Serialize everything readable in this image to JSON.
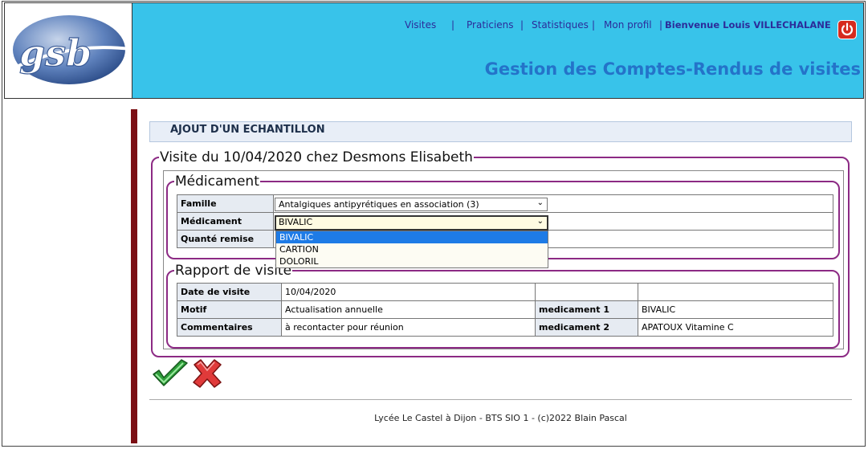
{
  "header": {
    "logo_text": "gsb",
    "nav": {
      "visites": "Visites",
      "praticiens": "Praticiens",
      "statistiques": "Statistiques",
      "profil": "Mon profil",
      "welcome": "Bienvenue Louis VILLECHALANE",
      "sep": "|"
    },
    "title": "Gestion des Comptes-Rendus de visites"
  },
  "section_title": "AJOUT D'UN ECHANTILLON",
  "visit_legend": "Visite du 10/04/2020 chez Desmons Elisabeth",
  "medicament": {
    "legend": "Médicament",
    "famille_label": "Famille",
    "famille_value": "Antalgiques antipyrétiques en association (3)",
    "medicament_label": "Médicament",
    "medicament_value": "BIVALIC",
    "quantite_label": "Quanté remise",
    "options": [
      "BIVALIC",
      "CARTION",
      "DOLORIL"
    ]
  },
  "rapport": {
    "legend": "Rapport de visite",
    "date_label": "Date de visite",
    "date_value": "10/04/2020",
    "motif_label": "Motif",
    "motif_value": "Actualisation annuelle",
    "commentaires_label": "Commentaires",
    "commentaires_value": "à recontacter pour réunion",
    "med1_label": "medicament 1",
    "med1_value": "BIVALIC",
    "med2_label": "medicament 2",
    "med2_value": "APATOUX Vitamine C"
  },
  "footer": "Lycée Le Castel à Dijon - BTS SIO 1 - (c)2022 Blain Pascal",
  "colors": {
    "header_bg": "#38c3ea",
    "accent": "#8c2a84",
    "title": "#2473c9",
    "highlight": "#1e7be6"
  }
}
